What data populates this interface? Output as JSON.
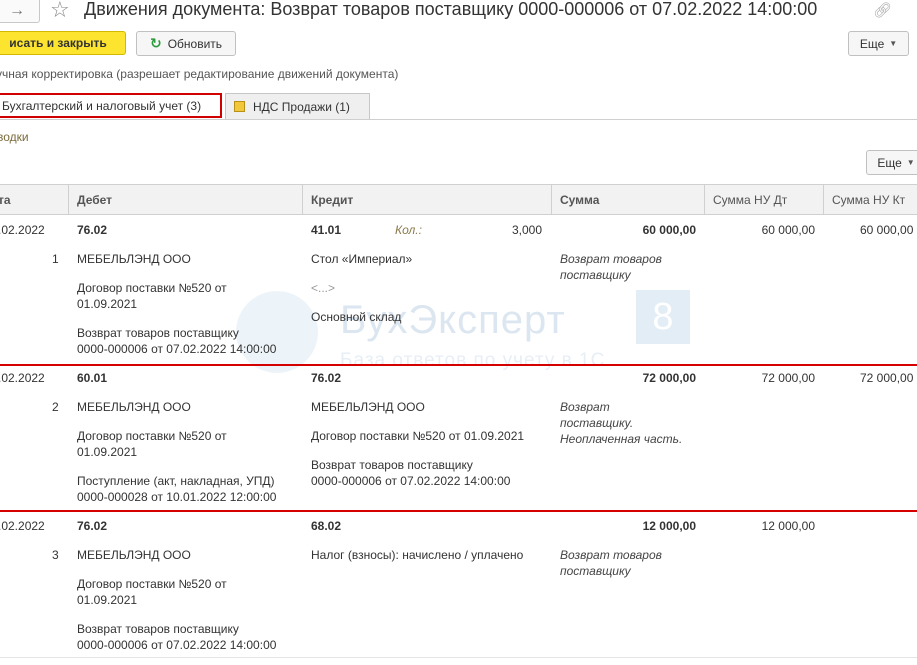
{
  "window": {
    "title": "Движения документа: Возврат товаров поставщику 0000-000006 от 07.02.2022 14:00:00"
  },
  "toolbar": {
    "post_close_label": "исать и закрыть",
    "refresh_label": "Обновить",
    "more_label": "Еще"
  },
  "manual_adjustment_label": "учная корректировка (разрешает редактирование движений документа)",
  "tabs": [
    {
      "label": "Бухгалтерский и налоговый учет (3)"
    },
    {
      "label": "НДС Продажи (1)"
    }
  ],
  "group_label": "водки",
  "table_toolbar": {
    "more_label": "Еще"
  },
  "columns": {
    "date": "та",
    "debit": "Дебет",
    "credit": "Кредит",
    "amount": "Сумма",
    "amount_nu_dt": "Сумма НУ Дт",
    "amount_nu_kt": "Сумма НУ Кт"
  },
  "rows": [
    {
      "date": ".02.2022",
      "num": "1",
      "debit_account": "76.02",
      "debit_sub1": "МЕБЕЛЬЛЭНД ООО",
      "debit_sub2_a": "Договор поставки №520 от",
      "debit_sub2_b": "01.09.2021",
      "debit_sub3_a": "Возврат товаров поставщику",
      "debit_sub3_b": "0000-000006 от 07.02.2022 14:00:00",
      "credit_account": "41.01",
      "qty_label": "Кол.:",
      "qty_value": "3,000",
      "credit_sub1": "Стол «Империал»",
      "credit_sub2": "<...>",
      "credit_sub3": "Основной склад",
      "amount": "60 000,00",
      "content_a": "Возврат товаров",
      "content_b": "поставщику",
      "amount_nu_dt": "60 000,00",
      "amount_nu_kt": "60 000,00"
    },
    {
      "date": ".02.2022",
      "num": "2",
      "debit_account": "60.01",
      "debit_sub1": "МЕБЕЛЬЛЭНД ООО",
      "debit_sub2_a": "Договор поставки №520 от",
      "debit_sub2_b": "01.09.2021",
      "debit_sub3_a": "Поступление (акт, накладная, УПД)",
      "debit_sub3_b": "0000-000028 от 10.01.2022 12:00:00",
      "credit_account": "76.02",
      "credit_sub1": "МЕБЕЛЬЛЭНД ООО",
      "credit_sub2": "Договор поставки №520 от 01.09.2021",
      "credit_sub3_a": "Возврат товаров поставщику",
      "credit_sub3_b": "0000-000006 от 07.02.2022 14:00:00",
      "amount": "72 000,00",
      "content_a": "Возврат",
      "content_b": "поставщику.",
      "content_c": "Неоплаченная часть.",
      "amount_nu_dt": "72 000,00",
      "amount_nu_kt": "72 000,00"
    },
    {
      "date": ".02.2022",
      "num": "3",
      "debit_account": "76.02",
      "debit_sub1": "МЕБЕЛЬЛЭНД ООО",
      "debit_sub2_a": "Договор поставки №520 от",
      "debit_sub2_b": "01.09.2021",
      "debit_sub3_a": "Возврат товаров поставщику",
      "debit_sub3_b": "0000-000006 от 07.02.2022 14:00:00",
      "credit_account": "68.02",
      "credit_sub1": "Налог (взносы): начислено / уплачено",
      "amount": "12 000,00",
      "content_a": "Возврат товаров",
      "content_b": "поставщику",
      "amount_nu_dt": "12 000,00"
    }
  ],
  "watermark": {
    "brand": "БухЭксперт",
    "badge": "8",
    "tagline": "База ответов по учету в 1С"
  },
  "icons": [
    "forward-arrow-icon",
    "star-icon",
    "link-icon",
    "refresh-icon",
    "document-icon",
    "chevron-down-icon"
  ],
  "colors": {
    "primary_button": "#fce42f",
    "highlight_border": "#d10000",
    "refresh_icon": "#2b9a3c"
  }
}
